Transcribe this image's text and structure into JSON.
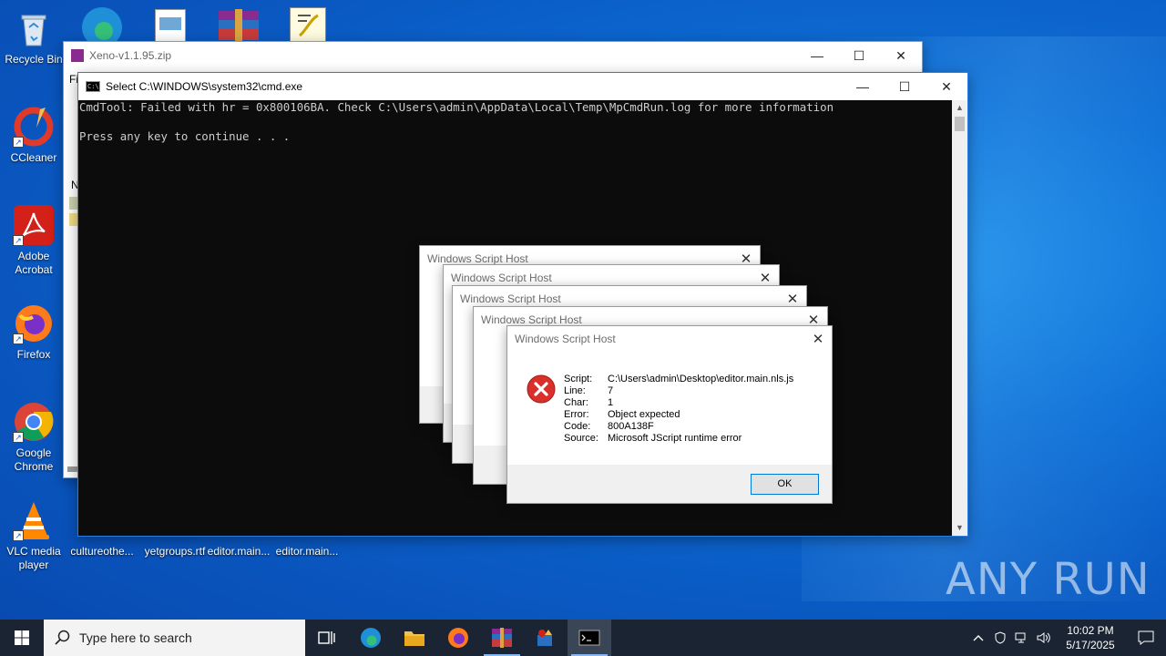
{
  "desktop": {
    "icons": [
      {
        "label": "Recycle Bin"
      },
      {
        "label": "CCleaner"
      },
      {
        "label": "Adobe Acrobat"
      },
      {
        "label": "Firefox"
      },
      {
        "label": "Google Chrome"
      },
      {
        "label": "VLC media player"
      }
    ],
    "bottom_files": [
      "cultureothe...",
      "yetgroups.rtf",
      "editor.main...",
      "editor.main..."
    ],
    "watermark": "ANY RUN"
  },
  "zip_window": {
    "title": "Xeno-v1.1.95.zip",
    "menu_stub": "Fi",
    "col_stub": "N"
  },
  "cmd_window": {
    "title": "Select C:\\WINDOWS\\system32\\cmd.exe",
    "lines": [
      "CmdTool: Failed with hr = 0x800106BA. Check C:\\Users\\admin\\AppData\\Local\\Temp\\MpCmdRun.log for more information",
      "",
      "Press any key to continue . . ."
    ]
  },
  "dialogs": {
    "title": "Windows Script Host",
    "error": {
      "labels": {
        "script": "Script:",
        "line": "Line:",
        "char": "Char:",
        "error": "Error:",
        "code": "Code:",
        "source": "Source:"
      },
      "values": {
        "script": "C:\\Users\\admin\\Desktop\\editor.main.nls.js",
        "line": "7",
        "char": "1",
        "error": "Object expected",
        "code": "800A138F",
        "source": "Microsoft JScript runtime error"
      },
      "ok_label": "OK"
    }
  },
  "taskbar": {
    "search_placeholder": "Type here to search",
    "time": "10:02 PM",
    "date": "5/17/2025"
  },
  "colors": {
    "accent": "#0a5bc4",
    "cmd_bg": "#0c0c0c",
    "error_red": "#d9302c"
  }
}
